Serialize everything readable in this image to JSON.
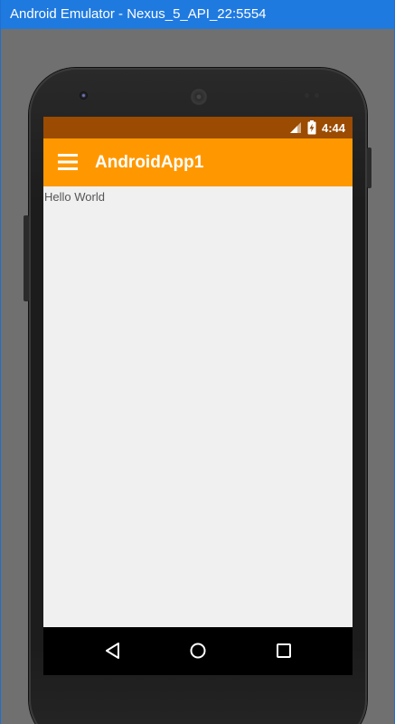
{
  "window": {
    "title": "Android Emulator - Nexus_5_API_22:5554"
  },
  "status_bar": {
    "time": "4:44",
    "icons": [
      "signal-icon",
      "battery-charging-icon"
    ]
  },
  "app_bar": {
    "title": "AndroidApp1",
    "menu_icon": "hamburger-menu-icon",
    "color": "#ff9800"
  },
  "content": {
    "text": "Hello World"
  },
  "navigation_bar": {
    "buttons": [
      "back-icon",
      "home-icon",
      "recents-icon"
    ]
  },
  "colors": {
    "status_bar": "#9b4b02",
    "app_bar": "#ff9800",
    "content_bg": "#f0f0f0",
    "title_bar": "#1f7ae0"
  }
}
